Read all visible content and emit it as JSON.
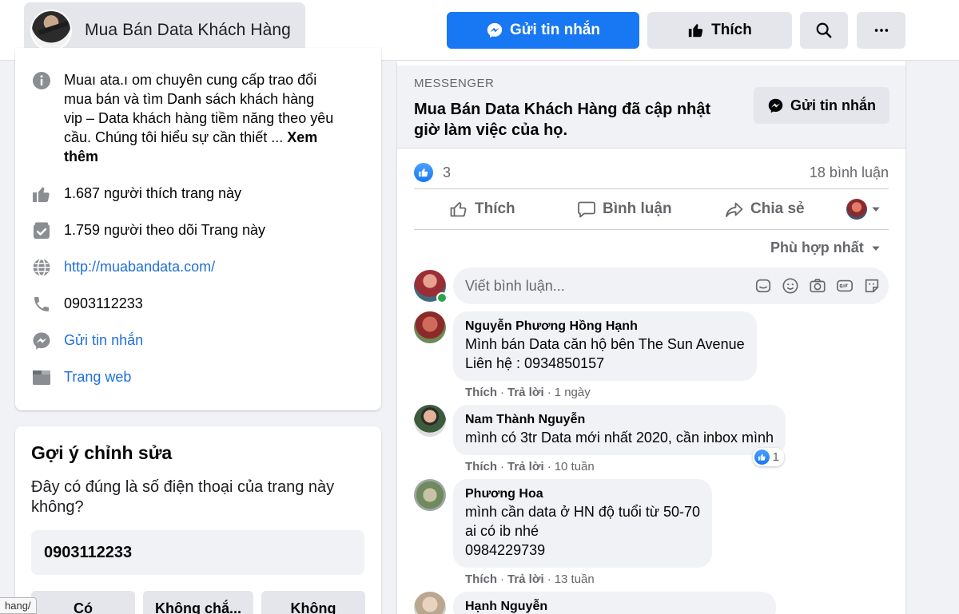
{
  "header": {
    "page_name": "Mua Bán Data Khách Hàng",
    "send_message_label": "Gửi tin nhắn",
    "like_label": "Thích"
  },
  "about": {
    "description_prefix": "Muaı ata.ı om chuyên cung cấp trao đổi mua bán và tìm Danh sách khách hàng vip – Data khách hàng tiềm năng theo yêu cầu. Chúng tôi hiểu sự cần thiết ... ",
    "see_more": "Xem thêm",
    "likes": "1.687 người thích trang này",
    "followers": "1.759 người theo dõi Trang này",
    "website_url": "http://muabandata.com/",
    "phone": "0903112233",
    "send_message": "Gửi tin nhắn",
    "website_label": "Trang web"
  },
  "suggest": {
    "title": "Gợi ý chỉnh sửa",
    "question": "Đây có đúng là số điện thoại của trang này không?",
    "phone": "0903112233",
    "yes": "Có",
    "not_sure": "Không chắ...",
    "no": "Không"
  },
  "status_url": "hang/",
  "post": {
    "messenger_label": "MESSENGER",
    "messenger_title": "Mua Bán Data Khách Hàng đã cập nhật giờ làm việc của họ.",
    "messenger_button": "Gửi tin nhắn",
    "reaction_count": "3",
    "comment_count": "18 bình luận",
    "actions": {
      "like": "Thích",
      "comment": "Bình luận",
      "share": "Chia sẻ"
    },
    "sort_label": "Phù hợp nhất",
    "write_placeholder": "Viết bình luận..."
  },
  "comments": [
    {
      "author": "Nguyễn Phương Hồng Hạnh",
      "text": "Mình bán Data căn hộ bên The Sun Avenue\nLiên hệ : 0934850157",
      "like": "Thích",
      "reply": "Trả lời",
      "time": "1 ngày"
    },
    {
      "author": "Nam Thành Nguyễn",
      "text": "mình có 3tr Data mới nhất 2020, cần inbox mình",
      "like": "Thích",
      "reply": "Trả lời",
      "time": "10 tuần",
      "reactions": "1"
    },
    {
      "author": "Phương Hoa",
      "text": "mình cần data ở HN độ tuổi từ 50-70\nai có ib nhé\n0984229739",
      "like": "Thích",
      "reply": "Trả lời",
      "time": "13 tuần"
    },
    {
      "author": "Hạnh Nguyễn"
    }
  ],
  "colors": {
    "primary": "#1877f2",
    "link": "#216fdb",
    "secondary_text": "#65676b",
    "background": "#f0f2f5"
  }
}
